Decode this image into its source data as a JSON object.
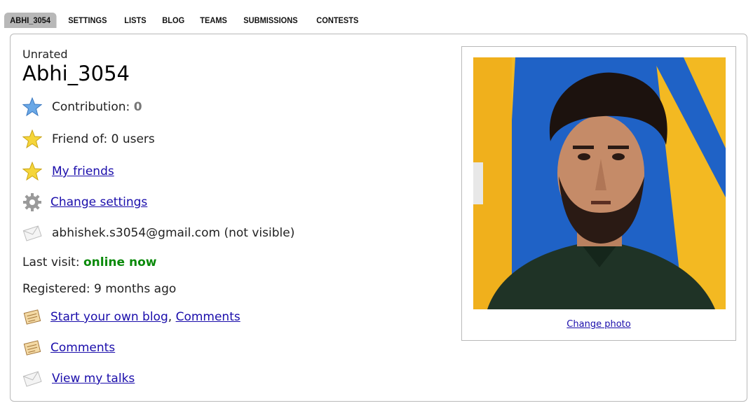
{
  "tabs": [
    {
      "label": "ABHI_3054",
      "active": true
    },
    {
      "label": "SETTINGS"
    },
    {
      "label": "LISTS"
    },
    {
      "label": "BLOG"
    },
    {
      "label": "TEAMS"
    },
    {
      "label": "SUBMISSIONS"
    },
    {
      "label": "CONTESTS"
    }
  ],
  "profile": {
    "rank": "Unrated",
    "handle": "Abhi_3054",
    "contribution_label": "Contribution:",
    "contribution_value": "0",
    "friend_of": "Friend of: 0 users",
    "my_friends": "My friends",
    "change_settings": "Change settings",
    "email": "abhishek.s3054@gmail.com (not visible)",
    "last_visit_label": "Last visit:",
    "last_visit_value": "online now",
    "registered": "Registered: 9 months ago",
    "blog_link": "Start your own blog",
    "comma": ",",
    "comments_link_1": "Comments",
    "comments_link_2": "Comments",
    "talks": "View my talks",
    "change_photo": "Change photo"
  },
  "icons": {
    "contribution": "blue-star-icon",
    "friend_of": "gold-star-icon",
    "my_friends": "gold-star-icon",
    "settings": "gear-icon",
    "email": "envelope-icon",
    "blog": "notepad-icon",
    "comments": "notepad-icon",
    "talks": "envelope-icon"
  },
  "colors": {
    "link": "#1a0dab",
    "online": "#0a8a0a",
    "active_tab": "#b8b8b8"
  }
}
